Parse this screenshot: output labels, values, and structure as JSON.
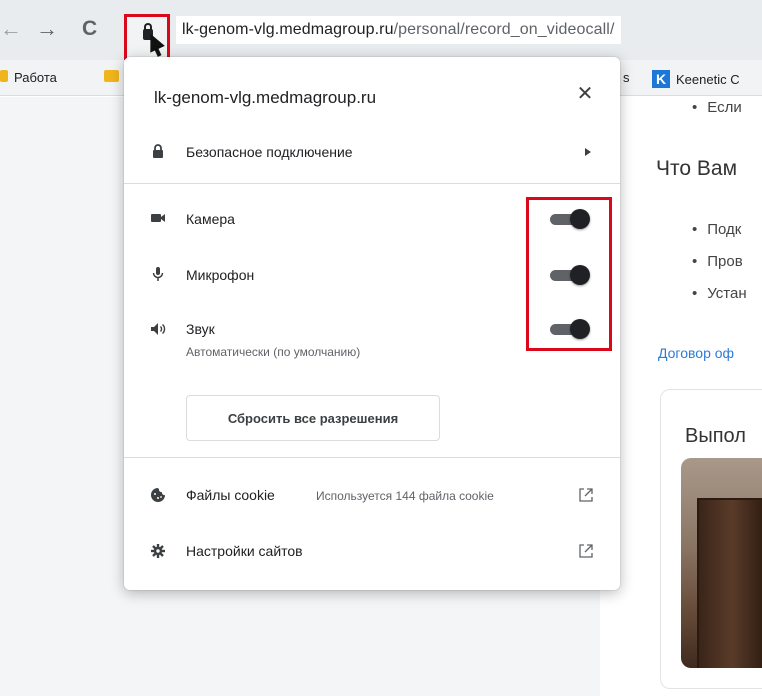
{
  "browser": {
    "url_host": "lk-genom-vlg.medmagroup.ru",
    "url_path": "/personal/record_on_videocall/",
    "nav": {
      "back": "←",
      "forward": "→",
      "reload": "C"
    }
  },
  "bookmarks": [
    {
      "label": "Работа",
      "icon": "folder-icon"
    },
    {
      "label": "s",
      "icon": ""
    },
    {
      "label": "Keenetic C",
      "icon": "keenetic-logo"
    }
  ],
  "popup": {
    "title": "lk-genom-vlg.medmagroup.ru",
    "close": "✕",
    "secure_connection": "Безопасное подключение",
    "permissions": [
      {
        "label": "Камера",
        "icon": "camera-icon",
        "enabled": true
      },
      {
        "label": "Микрофон",
        "icon": "microphone-icon",
        "enabled": true
      },
      {
        "label": "Звук",
        "sublabel": "Автоматически (по умолчанию)",
        "icon": "speaker-icon",
        "enabled": true
      }
    ],
    "reset_button": "Сбросить все разрешения",
    "cookies": {
      "label": "Файлы cookie",
      "detail": "Используется 144 файла cookie"
    },
    "site_settings": "Настройки сайтов"
  },
  "page": {
    "bullet_top": "Если",
    "heading": "Что Вам",
    "bullets": [
      "Подк",
      "Пров",
      "Устан"
    ],
    "link": "Договор оф",
    "card_title": "Выпол"
  },
  "colors": {
    "highlight": "#d9091b",
    "toggle_on": "#202124",
    "link": "#2d7bd8"
  }
}
